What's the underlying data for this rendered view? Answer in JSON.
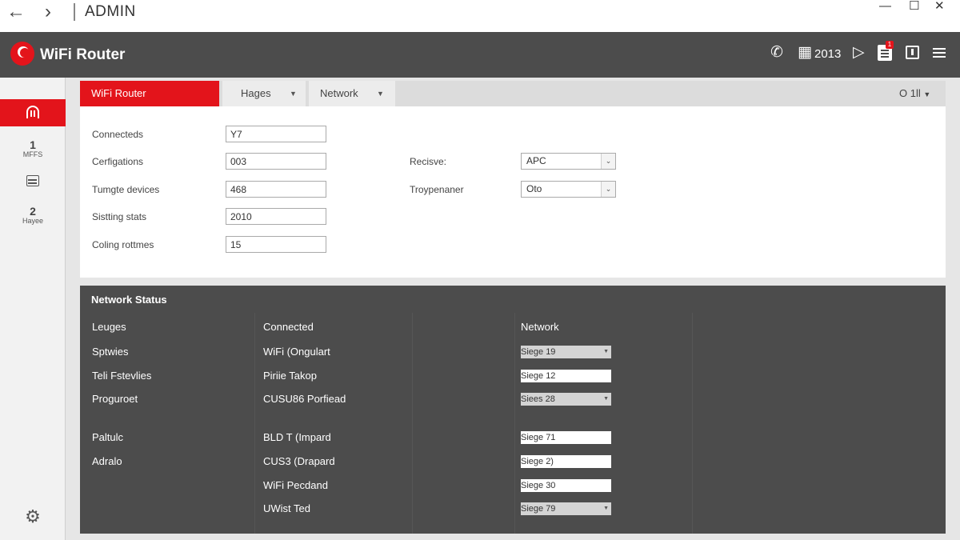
{
  "titlebar": {
    "back_icon": "arrow-left-icon",
    "forward_icon": "arrow-right-icon",
    "title": "ADMIN",
    "minimize": "—",
    "maximize": "☐",
    "close": "✕"
  },
  "header": {
    "brand": "WiFi Router",
    "year": "2013",
    "notification_badge": "1",
    "colors": {
      "header_bg": "#4c4c4c",
      "accent": "#e3141b"
    }
  },
  "sidebar": {
    "items": [
      {
        "icon": "wifi-router-icon",
        "active": true
      },
      {
        "number": "1",
        "caption": "MFFS"
      },
      {
        "icon": "grid-icon"
      },
      {
        "number": "2",
        "caption": "Hayee"
      },
      {
        "icon": "settings-gear-icon"
      }
    ]
  },
  "tabs": {
    "main": "WiFi Router",
    "hages": "Hages",
    "network": "Network",
    "right": "O 1ll"
  },
  "form": {
    "fields": [
      {
        "label": "Connecteds",
        "value": "Y7"
      },
      {
        "label": "Cerfigations",
        "value": "003"
      },
      {
        "label": "Tumgte devices",
        "value": "468"
      },
      {
        "label": "Sistting stats",
        "value": "2010"
      },
      {
        "label": "Coling rottmes",
        "value": "15"
      }
    ],
    "selects": [
      {
        "label": "Recisve:",
        "value": "APC"
      },
      {
        "label": "Troypenaner",
        "value": "Oto"
      }
    ]
  },
  "network_status": {
    "title": "Network Status",
    "columns": [
      "Leuges",
      "Connected",
      "Network"
    ],
    "col1": [
      "Sptwies",
      "Teli Fstevlies",
      "Proguroet",
      "Paltulc",
      "Adralo"
    ],
    "col2": [
      "WiFi (Ongulart",
      "Piriie Takop",
      "CUSU86 Porfiead",
      "BLD T (Impard",
      "CUS3 (Drapard",
      "WiFi Pecdand",
      "UWist Ted"
    ],
    "col3": [
      {
        "value": "Siege 19",
        "style": "sel"
      },
      {
        "value": "Siege 12",
        "style": "plain"
      },
      {
        "value": "Siees 28",
        "style": "sel"
      },
      {
        "value": "Siege 71",
        "style": "plain"
      },
      {
        "value": "Siege 2)",
        "style": "plain"
      },
      {
        "value": "Siege 30",
        "style": "plain"
      },
      {
        "value": "Siege 79",
        "style": "sel"
      }
    ]
  }
}
